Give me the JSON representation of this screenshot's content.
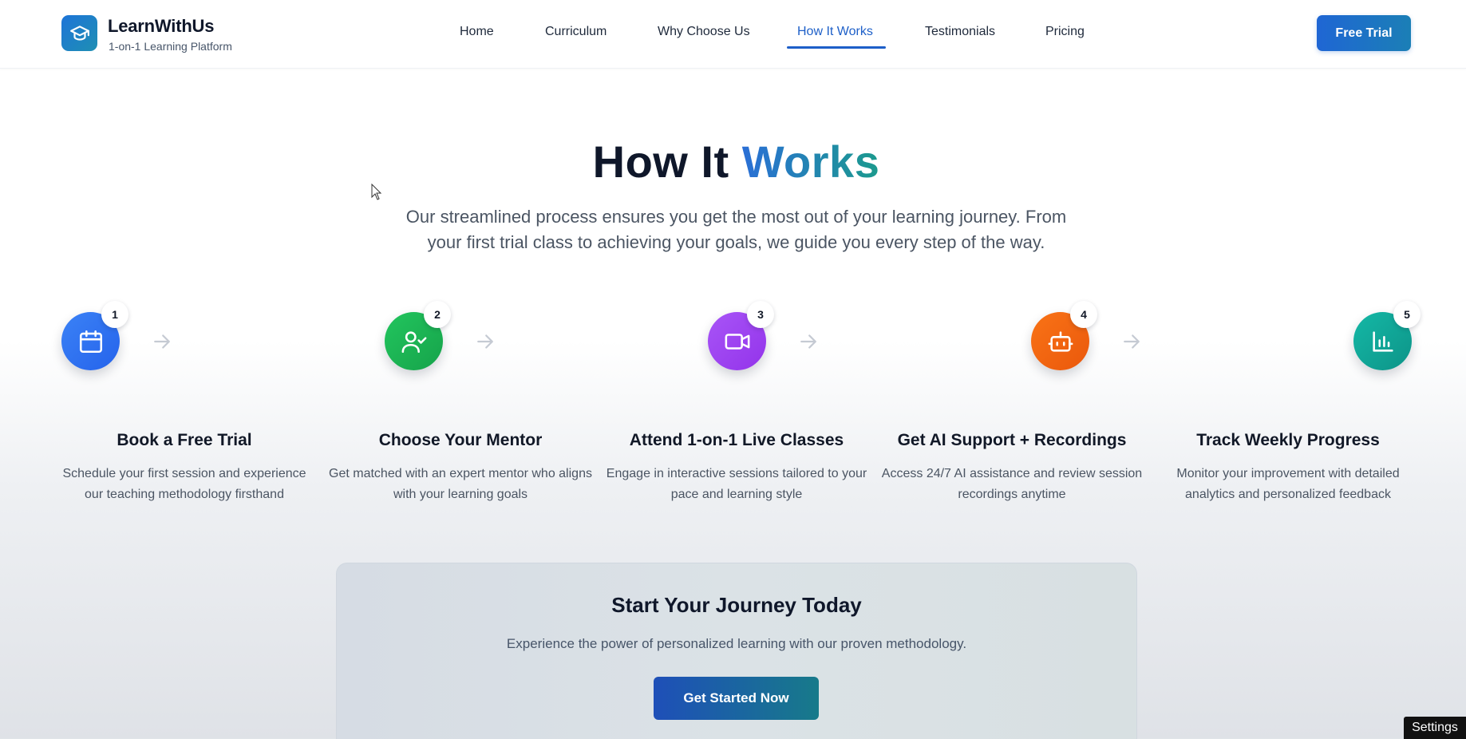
{
  "header": {
    "brand_name": "LearnWithUs",
    "brand_tagline": "1-on-1 Learning Platform",
    "logo_icon": "graduation-cap-icon",
    "nav": [
      {
        "label": "Home",
        "active": false
      },
      {
        "label": "Curriculum",
        "active": false
      },
      {
        "label": "Why Choose Us",
        "active": false
      },
      {
        "label": "How It Works",
        "active": true
      },
      {
        "label": "Testimonials",
        "active": false
      },
      {
        "label": "Pricing",
        "active": false
      }
    ],
    "cta_label": "Free Trial"
  },
  "hero": {
    "title_main": "How It",
    "title_accent": "Works",
    "subtitle": "Our streamlined process ensures you get the most out of your learning journey. From your first trial class to achieving your goals, we guide you every step of the way."
  },
  "steps": [
    {
      "number": "1",
      "icon": "calendar-icon",
      "color": "#2563eb",
      "title": "Book a Free Trial",
      "description": "Schedule your first session and experience our teaching methodology firsthand"
    },
    {
      "number": "2",
      "icon": "user-check-icon",
      "color": "#16a34a",
      "title": "Choose Your Mentor",
      "description": "Get matched with an expert mentor who aligns with your learning goals"
    },
    {
      "number": "3",
      "icon": "video-camera-icon",
      "color": "#9333ea",
      "title": "Attend 1-on-1 Live Classes",
      "description": "Engage in interactive sessions tailored to your pace and learning style"
    },
    {
      "number": "4",
      "icon": "robot-icon",
      "color": "#ea580c",
      "title": "Get AI Support + Recordings",
      "description": "Access 24/7 AI assistance and review session recordings anytime"
    },
    {
      "number": "5",
      "icon": "bar-chart-icon",
      "color": "#0d9488",
      "title": "Track Weekly Progress",
      "description": "Monitor your improvement with detailed analytics and personalized feedback"
    }
  ],
  "cta": {
    "title": "Start Your Journey Today",
    "subtitle": "Experience the power of personalized learning with our proven methodology.",
    "button_label": "Get Started Now"
  },
  "settings_label": "Settings",
  "colors": {
    "brand_blue": "#1d5fc8",
    "accent_teal": "#1b9a8d"
  }
}
